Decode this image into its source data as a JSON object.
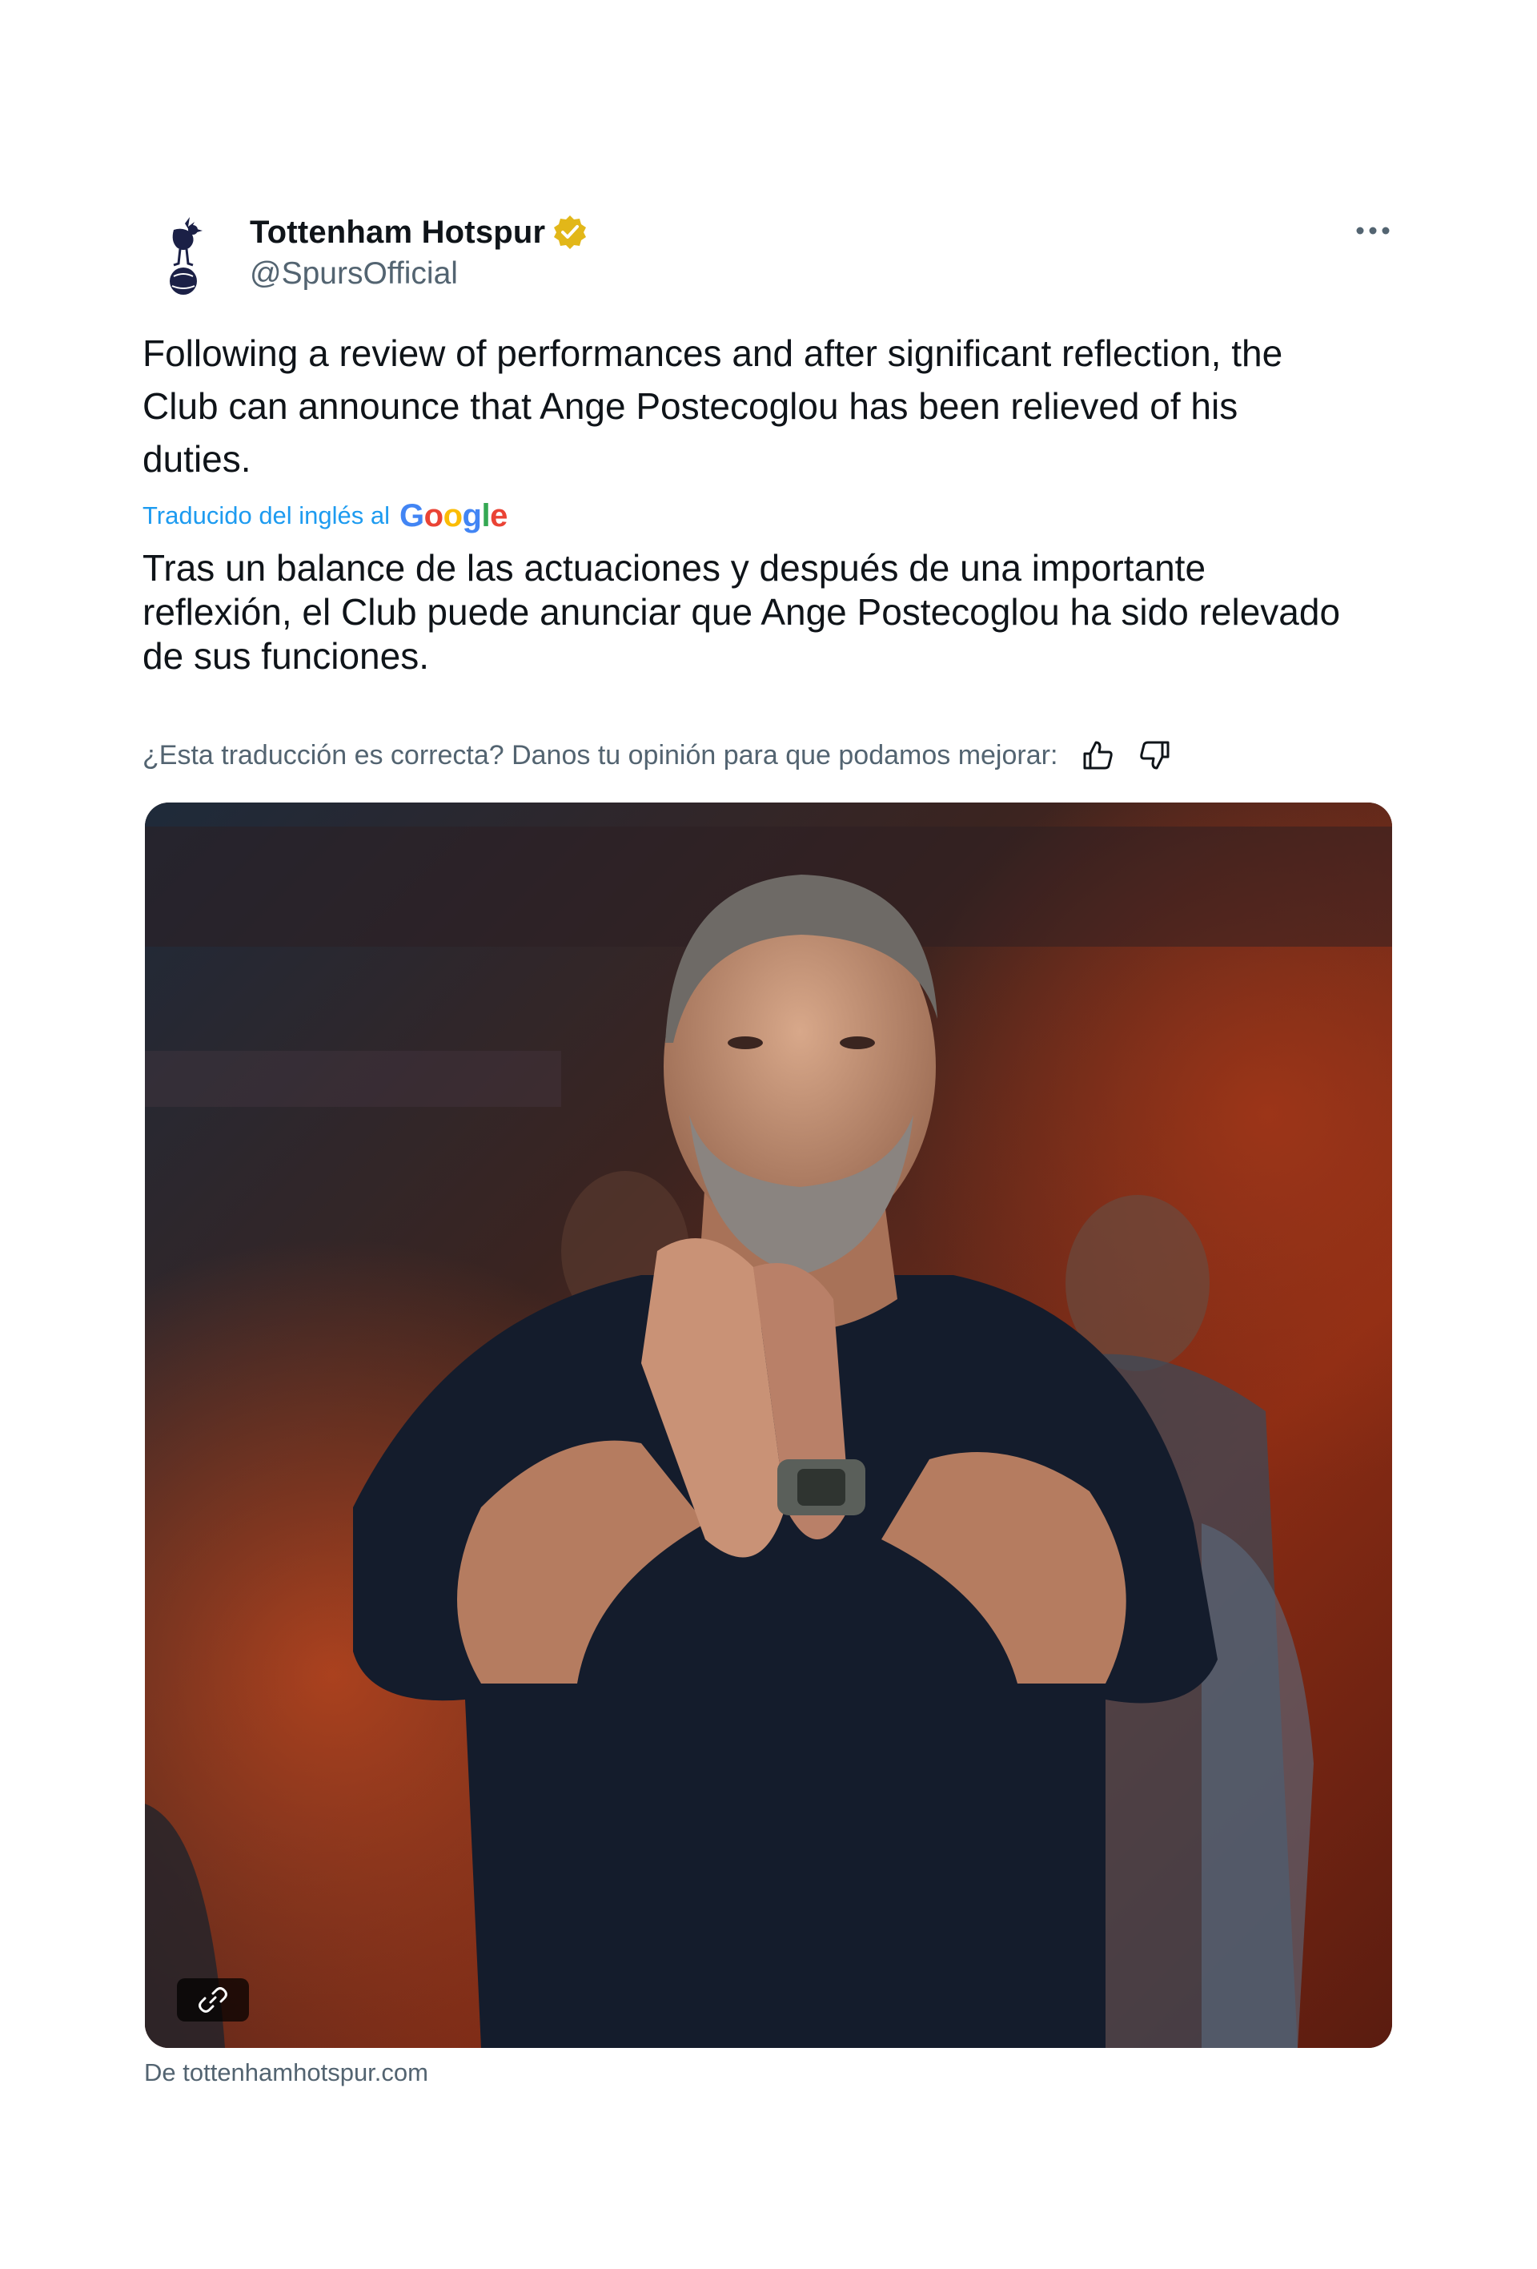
{
  "author": {
    "display_name": "Tottenham Hotspur",
    "handle": "@SpursOfficial",
    "verified_badge_color": "#e2b719",
    "avatar_icon": "spurs-cockerel-logo"
  },
  "more_icon": "more-horizontal-icon",
  "tweet": {
    "text_lines": [
      "Following a review of performances and after significant reflection, the",
      "Club can announce that Ange Postecoglou has been relieved of his",
      "duties."
    ]
  },
  "translation": {
    "label": "Traducido del inglés al",
    "provider": "Google",
    "text_lines": [
      "Tras un balance de las actuaciones y después de una importante",
      "reflexión, el Club puede anunciar que Ange Postecoglou ha sido relevado",
      "de sus funciones."
    ],
    "link_color": "#1d9bf0"
  },
  "feedback": {
    "question": "¿Esta traducción es correcta? Danos tu opinión para que podamos mejorar:",
    "thumbs_up_icon": "thumbs-up-icon",
    "thumbs_down_icon": "thumbs-down-icon"
  },
  "media": {
    "link_badge_icon": "link-icon",
    "source": "De tottenhamhotspur.com"
  }
}
